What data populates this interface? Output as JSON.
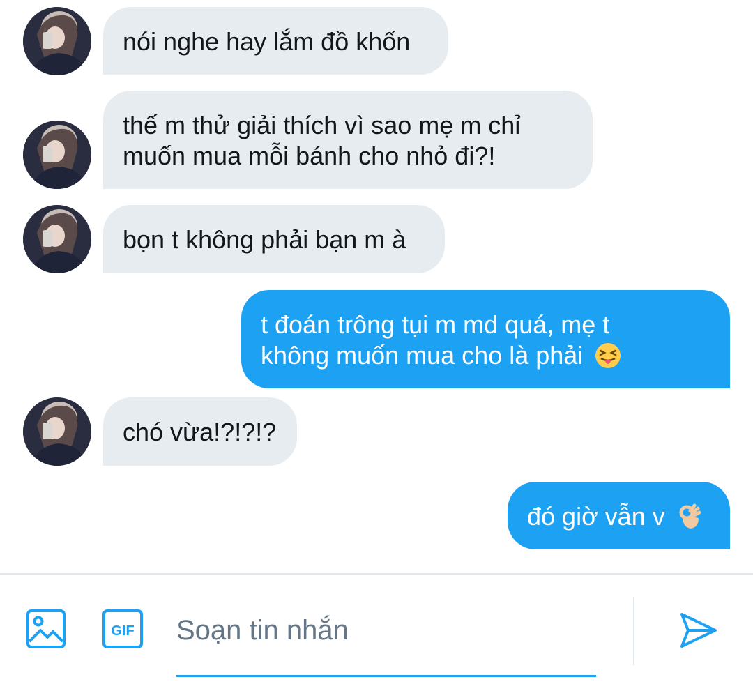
{
  "messages": [
    {
      "side": "in",
      "text": "nói nghe hay lắm đồ khốn"
    },
    {
      "side": "in",
      "line1": "thế m thử giải thích vì sao mẹ m chỉ",
      "line2": "muốn mua mỗi bánh cho nhỏ đi?!"
    },
    {
      "side": "in",
      "text": "bọn t không phải bạn m à"
    },
    {
      "side": "out",
      "line1": "t đoán trông tụi m md quá, mẹ t",
      "line2": "không muốn mua cho là phải",
      "emoji": "squinting-face-with-tongue-emoji"
    },
    {
      "side": "in",
      "text": "chó vừa!?!?!?"
    },
    {
      "side": "out",
      "text": "đó giờ vẫn v",
      "emoji": "ok-hand-emoji"
    }
  ],
  "composer": {
    "placeholder": "Soạn tin nhắn",
    "gif_label": "GIF",
    "icons": [
      "image-icon",
      "gif-icon",
      "send-icon"
    ]
  },
  "colors": {
    "accent": "#1da1f2",
    "incoming_bubble": "#e6ecf0",
    "text": "#14171a",
    "placeholder": "#657786"
  }
}
